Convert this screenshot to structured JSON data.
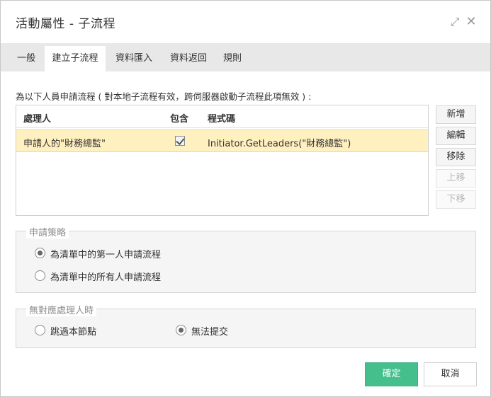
{
  "window": {
    "title": "活動屬性 - 子流程",
    "maximize_icon": "expand-arrows-icon",
    "close_icon": "close-icon"
  },
  "tabs": [
    {
      "label": "一般",
      "active": false
    },
    {
      "label": "建立子流程",
      "active": true
    },
    {
      "label": "資料匯入",
      "active": false
    },
    {
      "label": "資料返回",
      "active": false
    },
    {
      "label": "規則",
      "active": false
    }
  ],
  "description": "為以下人員申請流程 ( 對本地子流程有效，跨伺服器啟動子流程此項無效 ) :",
  "grid": {
    "columns": [
      "處理人",
      "包含",
      "程式碼"
    ],
    "rows": [
      {
        "handler": "申請人的\"財務總監\"",
        "include": true,
        "code": "Initiator.GetLeaders(\"財務總監\")",
        "selected": true
      }
    ],
    "selected_row_color": "#fff0c0"
  },
  "side_buttons": {
    "add": "新增",
    "edit": "編輯",
    "remove": "移除",
    "move_up": "上移",
    "move_down": "下移"
  },
  "strategy": {
    "legend": "申請策略",
    "options": [
      {
        "label": "為清單中的第一人申請流程",
        "selected": true
      },
      {
        "label": "為清單中的所有人申請流程",
        "selected": false
      }
    ]
  },
  "no_handler": {
    "legend": "無對應處理人時",
    "options": [
      {
        "label": "跳過本節點",
        "selected": false
      },
      {
        "label": "無法提交",
        "selected": true
      }
    ]
  },
  "footer": {
    "ok": "確定",
    "cancel": "取消",
    "ok_color": "#45c08c"
  }
}
